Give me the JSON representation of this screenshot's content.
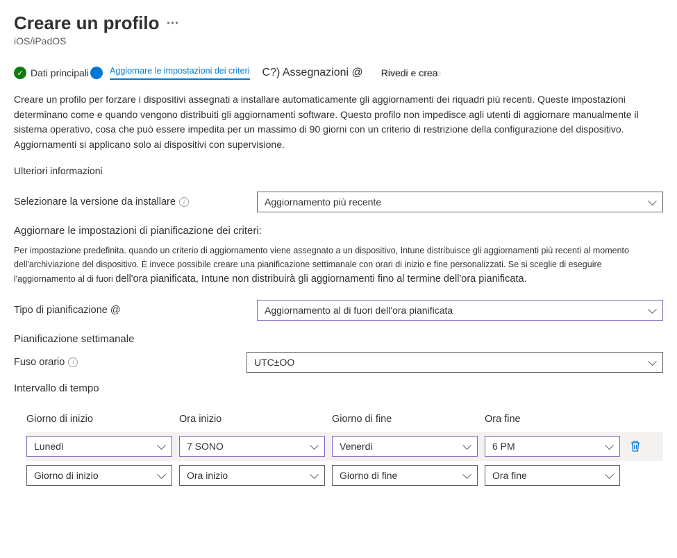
{
  "header": {
    "title": "Creare un profilo",
    "subtitle": "iOS/iPadOS"
  },
  "steps": {
    "step1": "Dati principali",
    "step2": "Aggiornare le impostazioni dei criteri",
    "step3": "C?) Assegnazioni @",
    "step4_overlay": "Rivedi e crea",
    "step4_ghost": "Review + create"
  },
  "description": "Creare un profilo per forzare i dispositivi assegnati a installare automaticamente gli aggiornamenti dei riquadri più recenti. Queste impostazioni determinano come e quando vengono distribuiti gli aggiornamenti software. Questo profilo non impedisce agli utenti di aggiornare manualmente il sistema operativo, cosa che può essere impedita per un massimo di 90 giorni con un criterio di restrizione della configurazione del dispositivo. Aggiornamenti si applicano solo ai dispositivi con supervisione.",
  "more_info": "Ulteriori informazioni",
  "fields": {
    "version_label": "Selezionare la versione da installare",
    "version_value": "Aggiornamento più recente",
    "schedule_heading": "Aggiornare le impostazioni di pianificazione dei criteri:",
    "schedule_desc_small": "Per impostazione predefinita. quando un criterio di aggiornamento viene assegnato a un dispositivo, Intune distribuisce gli aggiornamenti più recenti al momento dell'archiviazione del dispositivo. È invece possibile creare una pianificazione settimanale con orari di inizio e fine personalizzati. Se si sceglie di eseguire l'aggiornamento al di fuori",
    "schedule_desc_big": "dell'ora pianificata, Intune non distribuirà gli aggiornamenti fino al termine dell'ora pianificata.",
    "schedule_type_label": "Tipo di pianificazione @",
    "schedule_type_value": "Aggiornamento al di fuori dell'ora pianificata",
    "weekly_heading": "Pianificazione settimanale",
    "timezone_label": "Fuso orario",
    "timezone_value": "UTC±OO",
    "interval_heading": "Intervallo di tempo"
  },
  "schedule_table": {
    "headers": {
      "start_day": "Giorno di inizio",
      "start_time": "Ora inizio",
      "end_day": "Giorno di fine",
      "end_time": "Ora fine"
    },
    "rows": [
      {
        "start_day": "Lunedì",
        "start_time": "7 SONO",
        "end_day": "Venerdì",
        "end_time": "6 PM"
      },
      {
        "start_day": "Giorno di inizio",
        "start_time": "Ora inizio",
        "end_day": "Giorno di fine",
        "end_time": "Ora fine"
      }
    ]
  }
}
